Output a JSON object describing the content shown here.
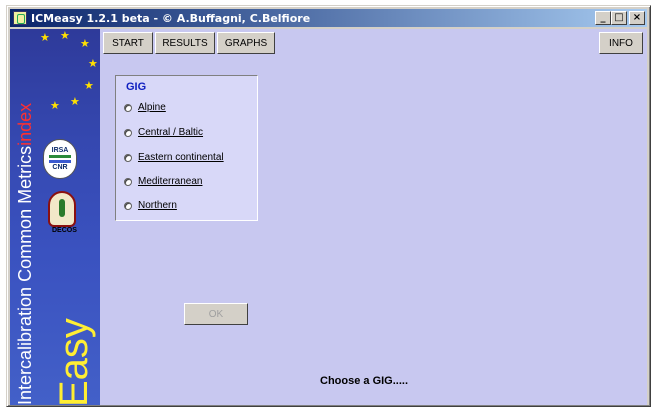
{
  "window": {
    "title": "ICMeasy 1.2.1 beta - © A.Buffagni, C.Belfiore",
    "controls": {
      "minimize": "_",
      "maximize": "□",
      "close": "×"
    }
  },
  "sidebar": {
    "vertical_text_main": "Intercalibration Common Metrics",
    "vertical_text_index": "index",
    "vertical_text_easy": "Easy",
    "logo_irsa_top": "IRSA",
    "logo_irsa_bottom": "CNR",
    "logo_deco": "DECOS"
  },
  "menu": {
    "start": "START",
    "results": "RESULTS",
    "graphs": "GRAPHS",
    "info": "INFO"
  },
  "gig": {
    "title": "GIG",
    "options": [
      {
        "label": "Alpine"
      },
      {
        "label": "Central / Baltic"
      },
      {
        "label": "Eastern continental"
      },
      {
        "label": "Mediterranean"
      },
      {
        "label": "Northern"
      }
    ]
  },
  "ok_button": "OK",
  "status": "Choose a GIG.....",
  "colors": {
    "client_bg": "#c8c8f0",
    "title_gradient_start": "#0a246a",
    "gig_title": "#1020c0",
    "accent_yellow": "#ffee33",
    "index_red": "#ff3030"
  }
}
